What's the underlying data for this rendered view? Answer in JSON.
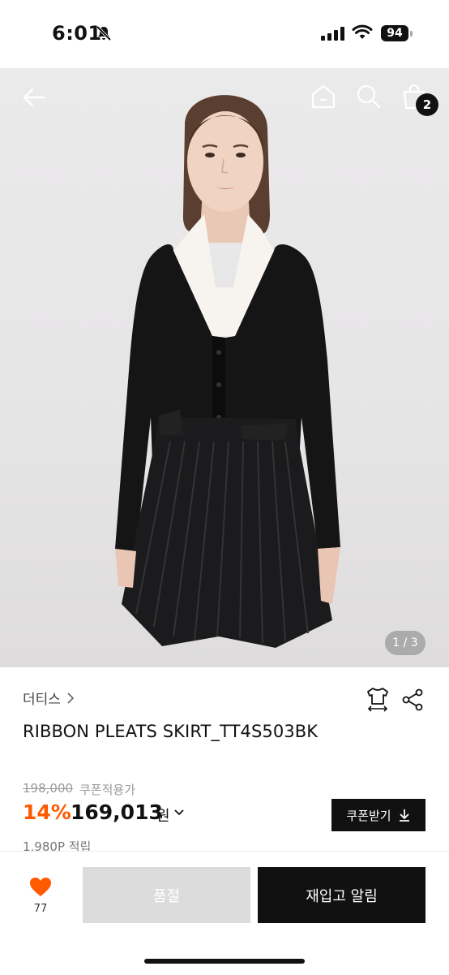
{
  "status_bar": {
    "time": "6:01",
    "battery": "94"
  },
  "gallery": {
    "counter": "1 / 3"
  },
  "header": {
    "cart_count": "2"
  },
  "product": {
    "brand": "더티스",
    "name": "RIBBON PLEATS SKIRT_TT4S503BK",
    "original_price": "198,000",
    "coupon_note": "쿠폰적용가",
    "discount": "14%",
    "sale_price": "169,013",
    "currency": "원",
    "coupon_button": "쿠폰받기",
    "points": "1,980P 적립"
  },
  "bottom_bar": {
    "like_count": "77",
    "soldout_label": "품절",
    "restock_label": "재입고 알림"
  },
  "colors": {
    "accent": "#ff5a00",
    "like": "#ff5a00",
    "dark": "#111111"
  }
}
